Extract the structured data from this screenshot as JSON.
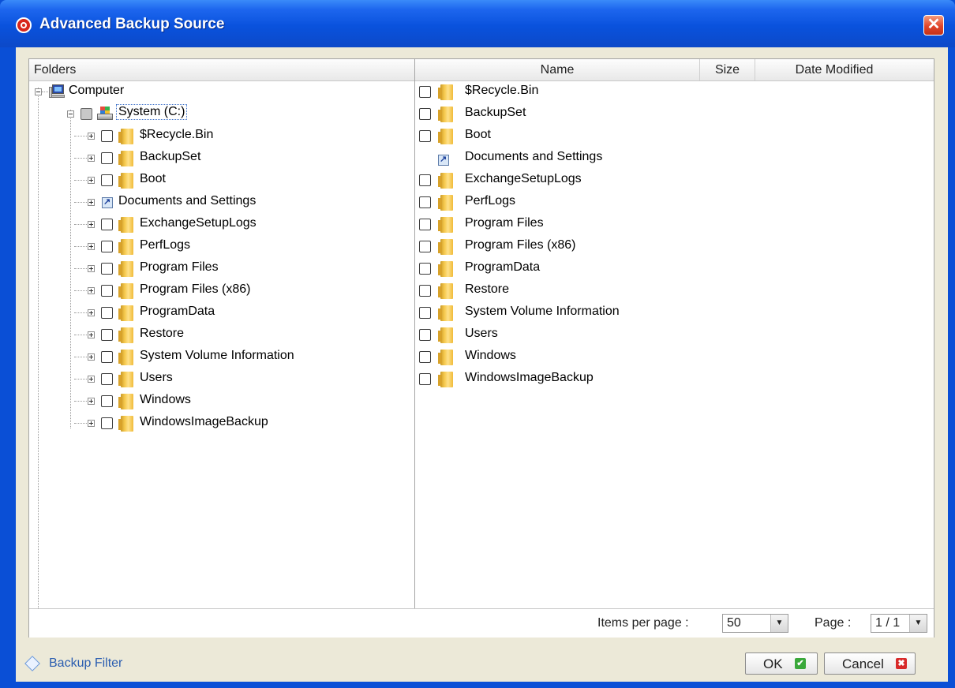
{
  "window": {
    "title": "Advanced Backup Source",
    "close_glyph": "✕"
  },
  "tree": {
    "header": "Folders",
    "root": "Computer",
    "drive": "System (C:)",
    "items": [
      {
        "label": "$Recycle.Bin",
        "type": "folder"
      },
      {
        "label": "BackupSet",
        "type": "folder"
      },
      {
        "label": "Boot",
        "type": "folder"
      },
      {
        "label": "Documents and Settings",
        "type": "shortcut"
      },
      {
        "label": "ExchangeSetupLogs",
        "type": "folder"
      },
      {
        "label": "PerfLogs",
        "type": "folder"
      },
      {
        "label": "Program Files",
        "type": "folder"
      },
      {
        "label": "Program Files (x86)",
        "type": "folder"
      },
      {
        "label": "ProgramData",
        "type": "folder"
      },
      {
        "label": "Restore",
        "type": "folder"
      },
      {
        "label": "System Volume Information",
        "type": "folder"
      },
      {
        "label": "Users",
        "type": "folder"
      },
      {
        "label": "Windows",
        "type": "folder"
      },
      {
        "label": "WindowsImageBackup",
        "type": "folder"
      }
    ]
  },
  "list": {
    "columns": {
      "name": "Name",
      "size": "Size",
      "date": "Date Modified"
    },
    "items": [
      {
        "label": "$Recycle.Bin",
        "type": "folder"
      },
      {
        "label": "BackupSet",
        "type": "folder"
      },
      {
        "label": "Boot",
        "type": "folder"
      },
      {
        "label": "Documents and Settings",
        "type": "shortcut"
      },
      {
        "label": "ExchangeSetupLogs",
        "type": "folder"
      },
      {
        "label": "PerfLogs",
        "type": "folder"
      },
      {
        "label": "Program Files",
        "type": "folder"
      },
      {
        "label": "Program Files (x86)",
        "type": "folder"
      },
      {
        "label": "ProgramData",
        "type": "folder"
      },
      {
        "label": "Restore",
        "type": "folder"
      },
      {
        "label": "System Volume Information",
        "type": "folder"
      },
      {
        "label": "Users",
        "type": "folder"
      },
      {
        "label": "Windows",
        "type": "folder"
      },
      {
        "label": "WindowsImageBackup",
        "type": "folder"
      }
    ]
  },
  "pager": {
    "items_per_page_label": "Items per page :",
    "items_per_page_value": "50",
    "page_label": "Page :",
    "page_value": "1 / 1"
  },
  "footer": {
    "backup_filter": "Backup Filter",
    "ok": "OK",
    "cancel": "Cancel",
    "ok_glyph": "✔",
    "cancel_glyph": "✖"
  },
  "colors": {
    "title_bar": "#0a52dd",
    "dialog_bg": "#ece9d8",
    "link": "#2a5db0"
  }
}
